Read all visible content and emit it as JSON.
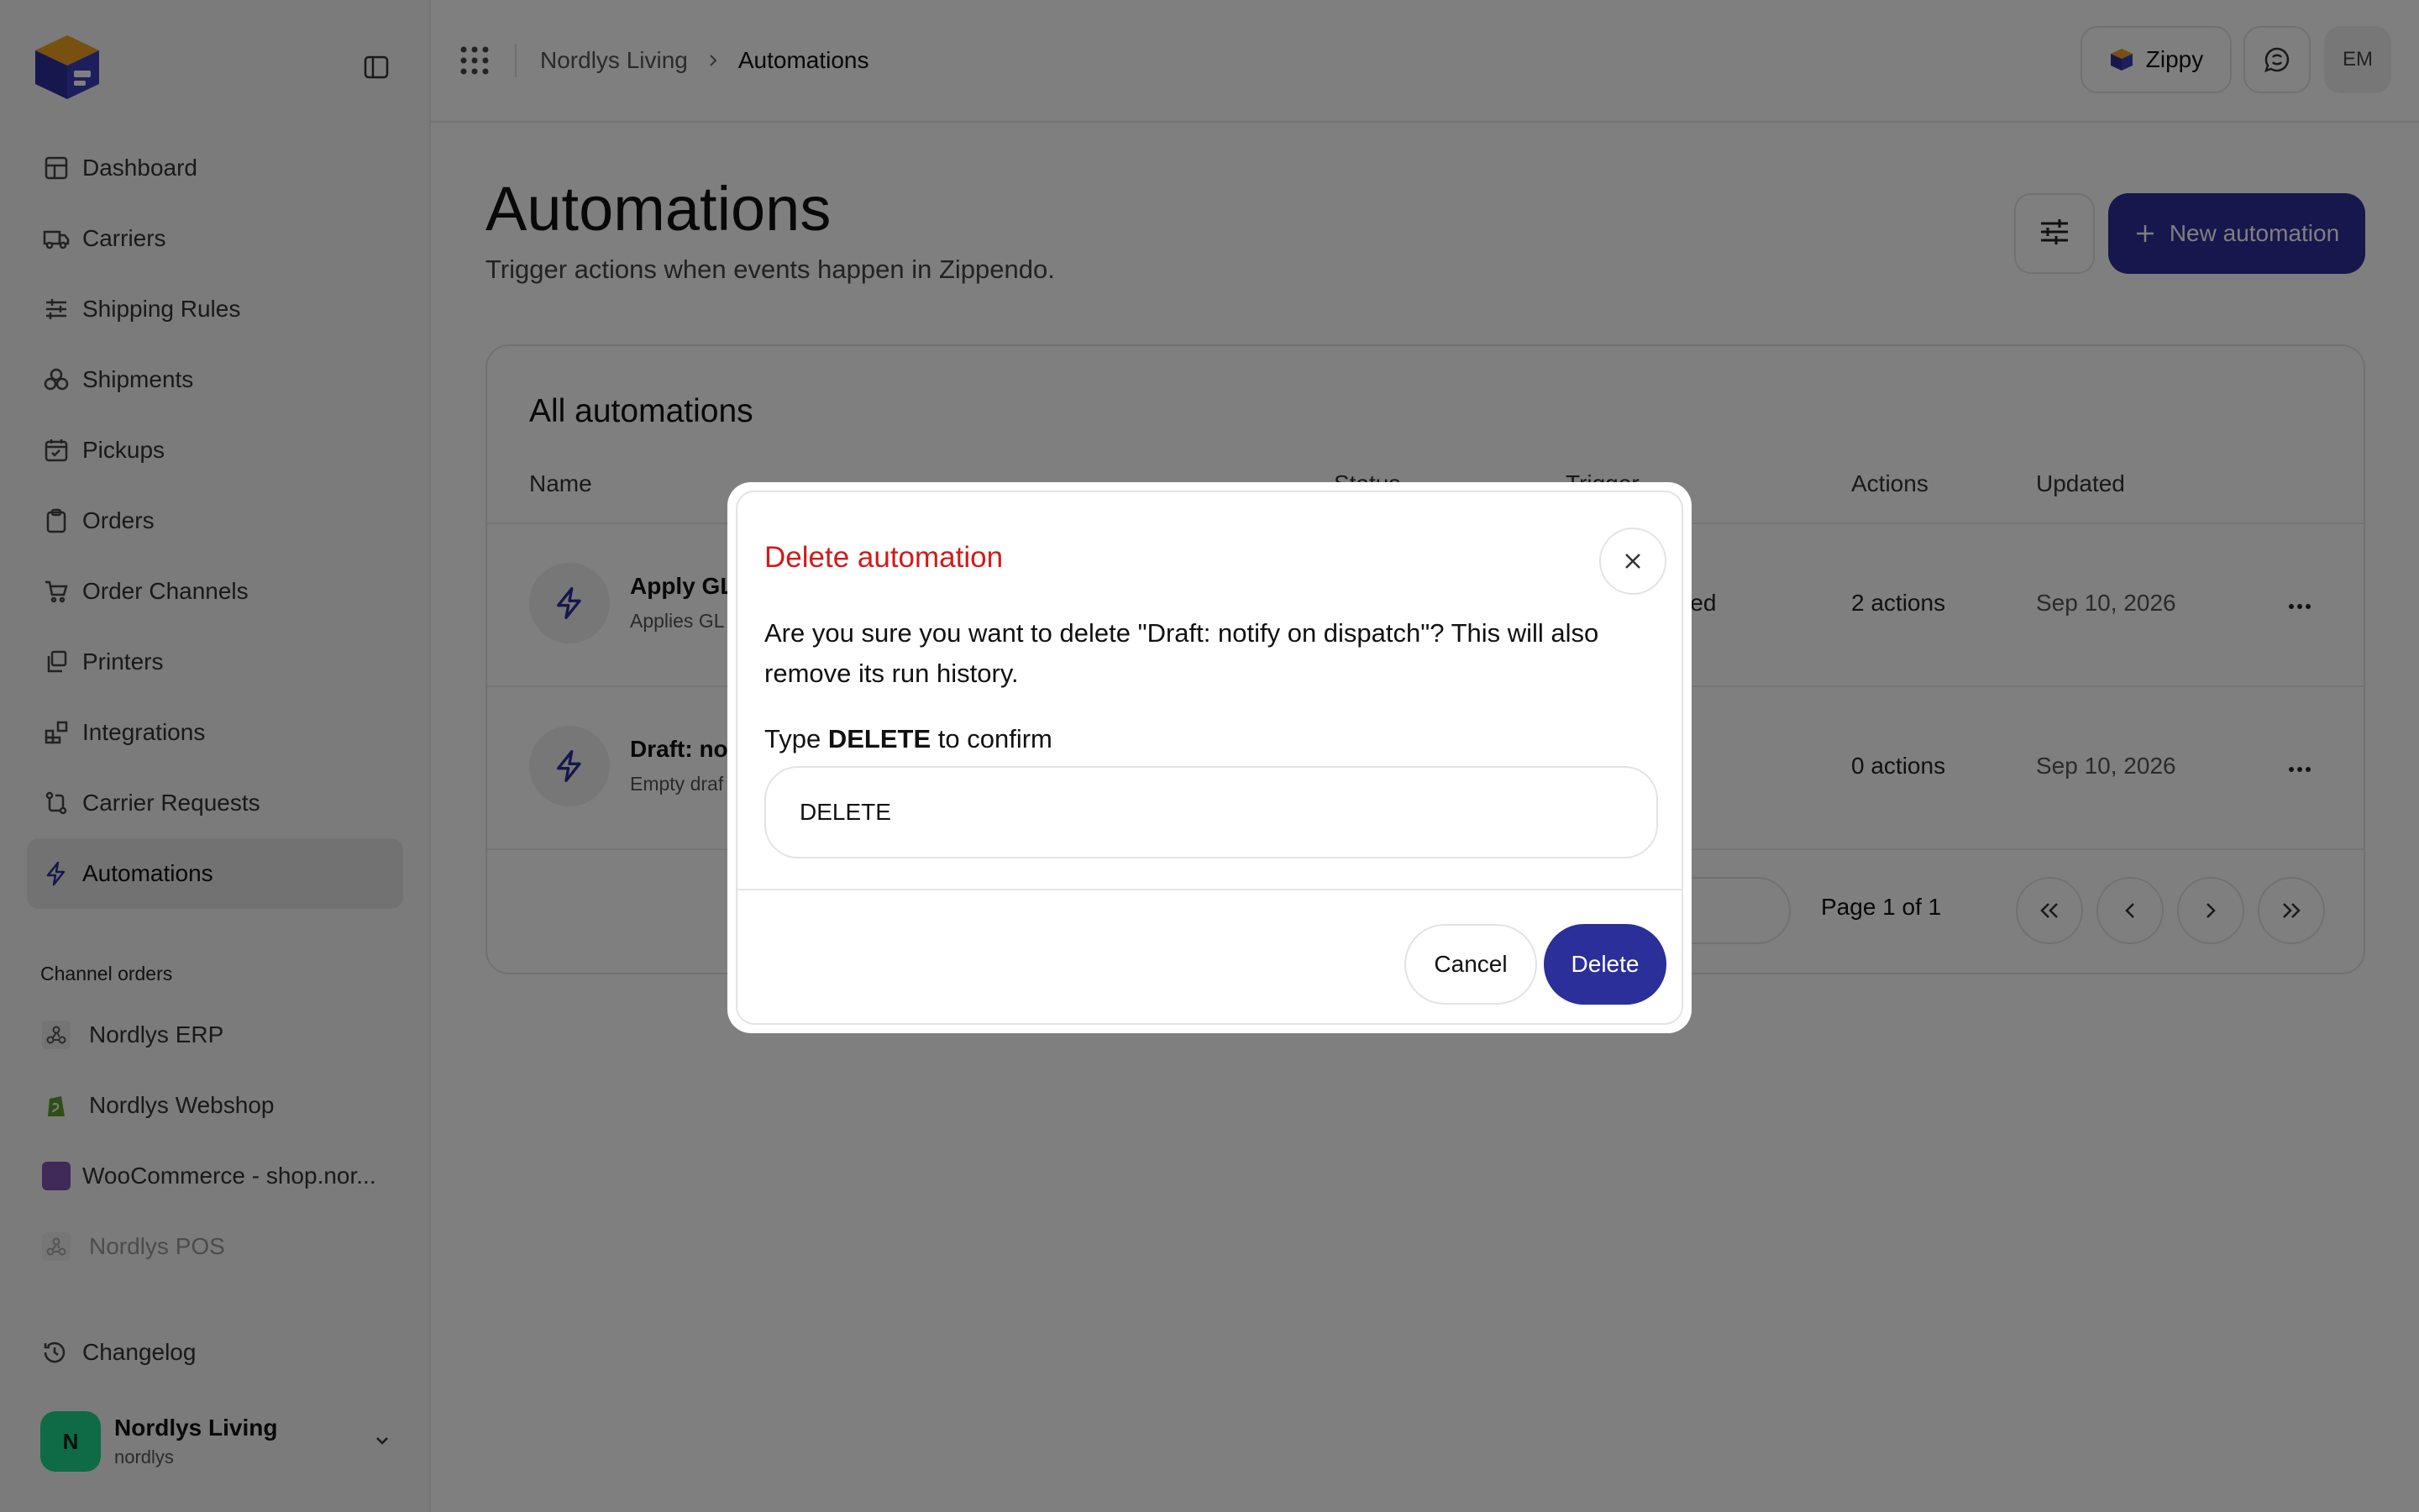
{
  "breadcrumb": {
    "org": "Nordlys Living",
    "current": "Automations"
  },
  "topbar": {
    "assistant_label": "Zippy",
    "user_initials": "EM"
  },
  "sidebar": {
    "items": [
      {
        "label": "Dashboard",
        "icon": "dashboard-icon"
      },
      {
        "label": "Carriers",
        "icon": "truck-icon"
      },
      {
        "label": "Shipping Rules",
        "icon": "sliders-icon"
      },
      {
        "label": "Shipments",
        "icon": "boxes-icon"
      },
      {
        "label": "Pickups",
        "icon": "calendar-check-icon"
      },
      {
        "label": "Orders",
        "icon": "clipboard-icon"
      },
      {
        "label": "Order Channels",
        "icon": "cart-icon"
      },
      {
        "label": "Printers",
        "icon": "printer-icon"
      },
      {
        "label": "Integrations",
        "icon": "blocks-icon"
      },
      {
        "label": "Carrier Requests",
        "icon": "route-icon"
      },
      {
        "label": "Automations",
        "icon": "bolt-icon",
        "active": true
      }
    ],
    "channels_label": "Channel orders",
    "channels": [
      {
        "label": "Nordlys ERP",
        "icon": "webhook-icon"
      },
      {
        "label": "Nordlys Webshop",
        "icon": "shopify-icon"
      },
      {
        "label": "WooCommerce - shop.nor...",
        "icon": "woocommerce-icon"
      },
      {
        "label": "Nordlys POS",
        "icon": "webhook-icon",
        "disabled": true
      }
    ],
    "changelog_label": "Changelog",
    "org": {
      "initial": "N",
      "name": "Nordlys Living",
      "slug": "nordlys"
    }
  },
  "page": {
    "title": "Automations",
    "subtitle": "Trigger actions when events happen in Zippendo.",
    "new_button": "New automation"
  },
  "table": {
    "title": "All automations",
    "columns": {
      "name": "Name",
      "status": "Status",
      "trigger": "Trigger",
      "actions": "Actions",
      "updated": "Updated"
    },
    "rows": [
      {
        "name": "Apply GL",
        "desc": "Applies GL",
        "trigger": "reated",
        "actions": "2 actions",
        "updated": "Sep 10, 2026"
      },
      {
        "name": "Draft: not",
        "desc": "Empty draf",
        "trigger": "",
        "actions": "0 actions",
        "updated": "Sep 10, 2026"
      }
    ],
    "pagination": "Page 1 of 1"
  },
  "modal": {
    "title": "Delete automation",
    "body": "Are you sure you want to delete \"Draft: notify on dispatch\"? This will also remove its run history.",
    "confirm_prefix": "Type",
    "confirm_keyword": "DELETE",
    "confirm_suffix": "to confirm",
    "input_value": "DELETE",
    "cancel_label": "Cancel",
    "delete_label": "Delete"
  },
  "colors": {
    "accent": "#2b2f9a",
    "danger": "#d11a1a",
    "org_avatar": "#1ed68a"
  }
}
